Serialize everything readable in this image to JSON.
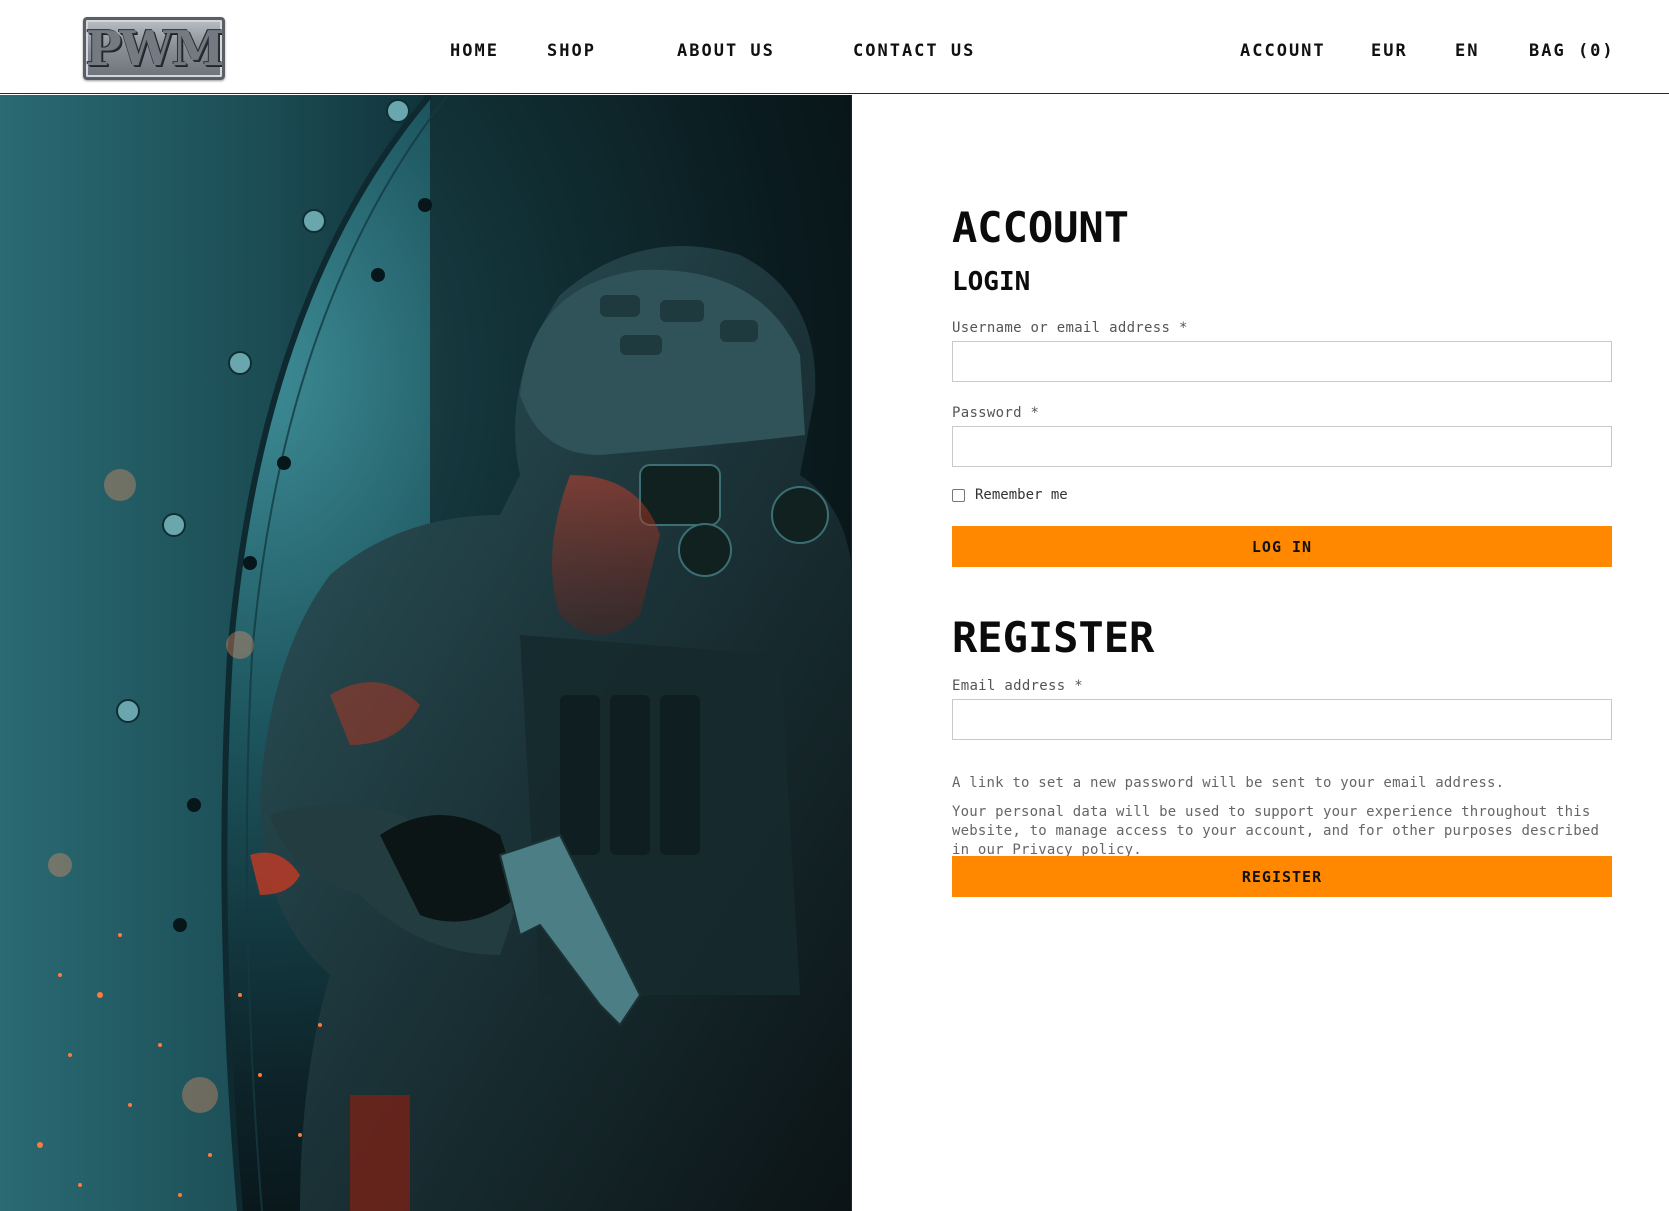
{
  "brand": {
    "logo_text": "PWM"
  },
  "nav": {
    "home": "HOME",
    "shop": "SHOP",
    "about": "ABOUT US",
    "contact": "CONTACT US",
    "account": "ACCOUNT",
    "currency": "EUR",
    "language": "EN",
    "bag": "BAG (0)"
  },
  "account": {
    "title": "ACCOUNT",
    "login": {
      "heading": "LOGIN",
      "username_label": "Username or email address *",
      "username_value": "",
      "password_label": "Password *",
      "password_value": "",
      "remember_label": "Remember me",
      "remember_checked": false,
      "submit_label": "LOG IN"
    },
    "register": {
      "heading": "REGISTER",
      "email_label": "Email address *",
      "email_value": "",
      "link_note": "A link to set a new password will be sent to your email address.",
      "privacy_note": "Your personal data will be used to support your experience throughout this website, to manage access to your account, and for other purposes described in our Privacy policy.",
      "submit_label": "REGISTER"
    }
  },
  "colors": {
    "accent": "#ff8800",
    "text": "#111111",
    "label": "#555555",
    "border": "#c9c9c9"
  },
  "icons": {
    "remember_checkbox": "checkbox-icon",
    "hero": "soldier-photo"
  }
}
